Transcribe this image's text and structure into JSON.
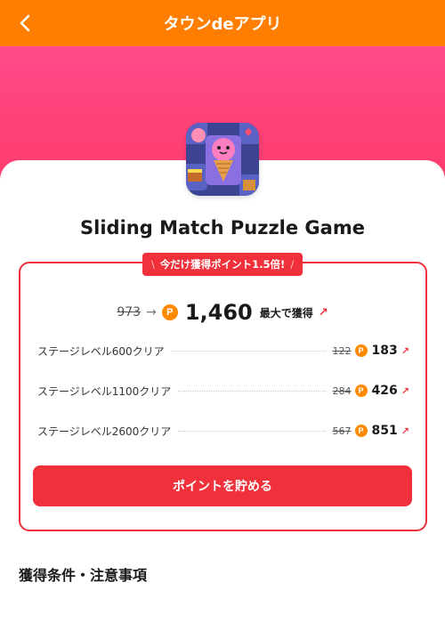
{
  "header": {
    "title": "タウンdeアプリ"
  },
  "app": {
    "name": "Sliding Match Puzzle Game"
  },
  "promo": {
    "badge": "今だけ獲得ポイント1.5倍!"
  },
  "reward": {
    "old_total": "973",
    "new_total": "1,460",
    "max_label": "最大で獲得",
    "coin_symbol": "P"
  },
  "stages": [
    {
      "label": "ステージレベル600クリア",
      "old": "122",
      "new": "183"
    },
    {
      "label": "ステージレベル1100クリア",
      "old": "284",
      "new": "426"
    },
    {
      "label": "ステージレベル2600クリア",
      "old": "567",
      "new": "851"
    }
  ],
  "cta": {
    "label": "ポイントを貯める"
  },
  "section": {
    "title": "獲得条件・注意事項"
  },
  "colors": {
    "header": "#ff7e00",
    "hero": "#ff4b8a",
    "accent": "#f0303a",
    "coin": "#ff8a00"
  }
}
